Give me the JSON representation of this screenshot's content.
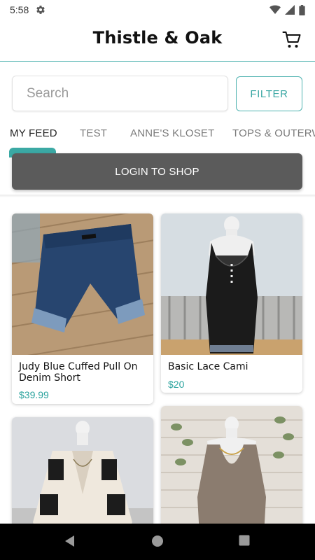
{
  "status_bar": {
    "time": "5:58"
  },
  "app_bar": {
    "title": "Thistle & Oak"
  },
  "search": {
    "placeholder": "Search",
    "value": ""
  },
  "filter": {
    "label": "FILTER"
  },
  "tabs": [
    {
      "label": "MY FEED"
    },
    {
      "label": "TEST"
    },
    {
      "label": "ANNE'S KLOSET"
    },
    {
      "label": "TOPS & OUTERW"
    }
  ],
  "active_tab": "MY FEED",
  "login": {
    "label": "LOGIN TO SHOP"
  },
  "products": [
    {
      "title": "Judy Blue Cuffed Pull On Denim Short",
      "price": "$39.99"
    },
    {
      "title": "Basic Lace Cami",
      "price": "$20"
    },
    {
      "title": "",
      "price": ""
    },
    {
      "title": "",
      "price": ""
    }
  ],
  "colors": {
    "accent": "#3ba9a4",
    "login_bg": "#5b5b5b",
    "nav_bg": "#000000"
  }
}
